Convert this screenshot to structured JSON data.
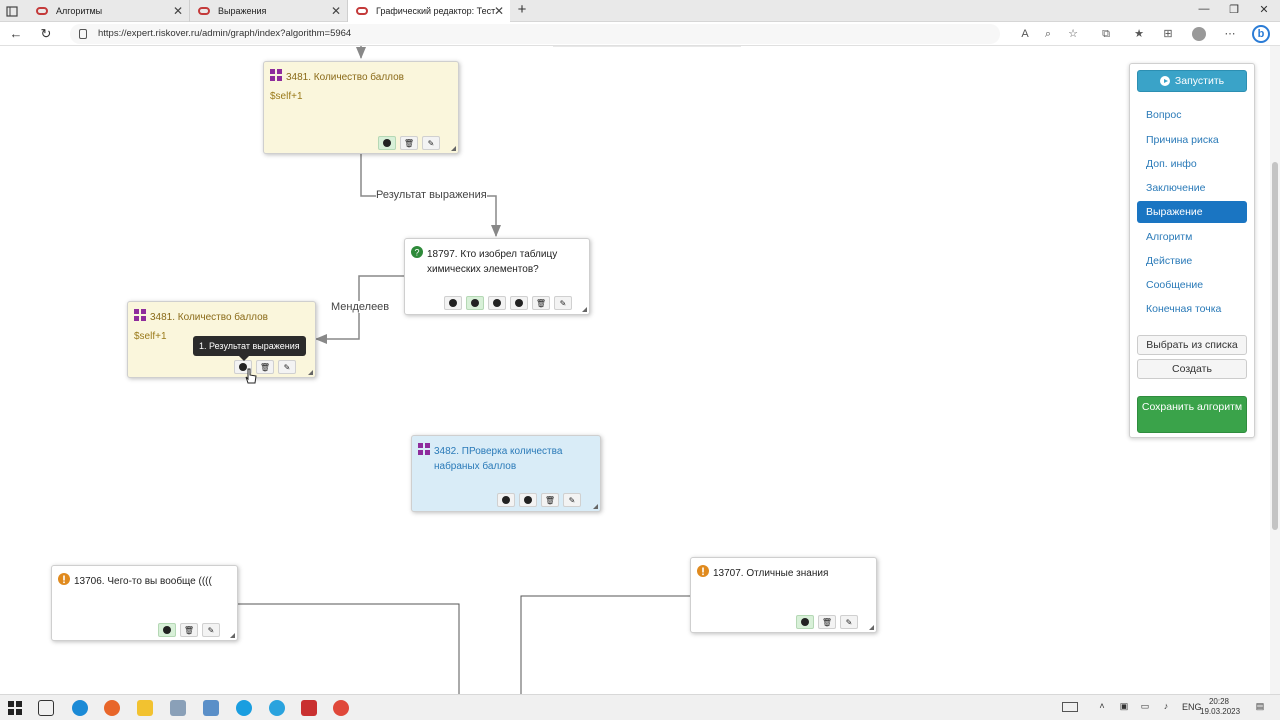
{
  "browser": {
    "tabs": [
      {
        "title": "Алгоритмы",
        "active": false
      },
      {
        "title": "Выражения",
        "active": false
      },
      {
        "title": "Графический редактор: Тест",
        "active": true
      }
    ],
    "url": "https://expert.riskover.ru/admin/graph/index?algorithm=5964",
    "url_host": "expert.riskover.ru"
  },
  "nodes": {
    "top_expr": {
      "title": "3481. Количество баллов",
      "body": "$self+1"
    },
    "question": {
      "title": "18797. Кто изобрел таблицу химических элементов?"
    },
    "left_expr": {
      "title": "3481. Количество баллов",
      "body": "$self+1"
    },
    "check_expr": {
      "title": "3482. ПРоверка количества набраных баллов"
    },
    "msg_left": {
      "title": "13706. Чего-то вы вообще (((("
    },
    "msg_right": {
      "title": "13707. Отличные знания"
    }
  },
  "edges": {
    "result_label": "Результат выражения",
    "mendeleev_label": "Менделеев"
  },
  "tooltip": "1. Результат выражения",
  "side_panel": {
    "run_label": "Запустить",
    "items": [
      "Вопрос",
      "Причина риска",
      "Доп. инфо",
      "Заключение",
      "Выражение",
      "Алгоритм",
      "Действие",
      "Сообщение",
      "Конечная точка"
    ],
    "active_item": "Выражение",
    "choose_label": "Выбрать из списка",
    "create_label": "Создать",
    "save_label": "Сохранить алгоритм"
  },
  "taskbar": {
    "lang": "ENG",
    "time": "20:28",
    "date": "19.03.2023"
  },
  "colors": {
    "yellow_node": "#faf6dc",
    "blue_node": "#d9ecf7",
    "active_blue": "#1a75c2",
    "run_button": "#3aa3c8",
    "save_button": "#3aa34a"
  }
}
